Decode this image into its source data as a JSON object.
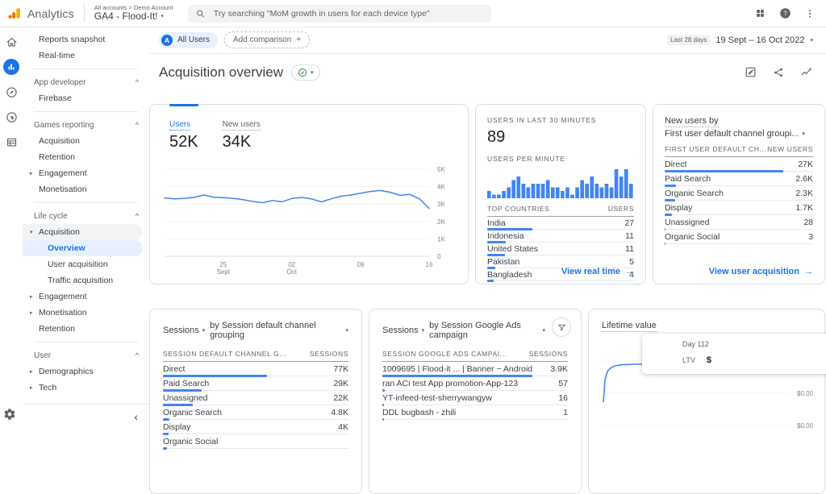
{
  "topbar": {
    "brand": "Analytics",
    "account_breadcrumb": "All accounts > Demo Account",
    "property_name": "GA4 - Flood-It!",
    "search_placeholder": "Try searching \"MoM growth in users for each device type\""
  },
  "comparison_bar": {
    "avatar_letter": "A",
    "all_users_label": "All Users",
    "add_comparison_label": "Add comparison",
    "add_icon": "+"
  },
  "date_range": {
    "preset": "Last 28 days",
    "range": "19 Sept – 16 Oct 2022"
  },
  "page": {
    "title": "Acquisition overview"
  },
  "sidebar": {
    "collapse_icon": "‹",
    "items": [
      {
        "type": "link",
        "label": "Reports snapshot"
      },
      {
        "type": "link",
        "label": "Real-time"
      },
      {
        "type": "divider"
      },
      {
        "type": "header",
        "label": "App developer"
      },
      {
        "type": "link",
        "label": "Firebase"
      },
      {
        "type": "divider"
      },
      {
        "type": "header",
        "label": "Games reporting"
      },
      {
        "type": "link",
        "label": "Acquisition"
      },
      {
        "type": "link",
        "label": "Retention"
      },
      {
        "type": "link",
        "label": "Engagement",
        "arrow": "right"
      },
      {
        "type": "link",
        "label": "Monetisation"
      },
      {
        "type": "divider"
      },
      {
        "type": "header",
        "label": "Life cycle"
      },
      {
        "type": "link",
        "label": "Acquisition",
        "arrow": "down",
        "active_parent": true
      },
      {
        "type": "link",
        "label": "Overview",
        "indent": 2,
        "selected": true
      },
      {
        "type": "link",
        "label": "User acquisition",
        "indent": 2
      },
      {
        "type": "link",
        "label": "Traffic acquisition",
        "indent": 2
      },
      {
        "type": "link",
        "label": "Engagement",
        "arrow": "right"
      },
      {
        "type": "link",
        "label": "Monetisation",
        "arrow": "right"
      },
      {
        "type": "link",
        "label": "Retention"
      },
      {
        "type": "divider"
      },
      {
        "type": "header",
        "label": "User"
      },
      {
        "type": "link",
        "label": "Demographics",
        "arrow": "right"
      },
      {
        "type": "link",
        "label": "Tech",
        "arrow": "right"
      }
    ]
  },
  "cards": {
    "users_trend": {
      "tabs": [
        {
          "label": "Users",
          "value": "52K"
        },
        {
          "label": "New users",
          "value": "34K"
        }
      ]
    },
    "realtime": {
      "title": "USERS IN LAST 30 MINUTES",
      "value": "89",
      "chart_label": "USERS PER MINUTE",
      "table_headers": [
        "TOP COUNTRIES",
        "USERS"
      ],
      "rows": [
        {
          "label": "India",
          "value": "27",
          "bar": 0.31
        },
        {
          "label": "Indonesia",
          "value": "11",
          "bar": 0.125
        },
        {
          "label": "United States",
          "value": "11",
          "bar": 0.12
        },
        {
          "label": "Pakistan",
          "value": "5",
          "bar": 0.055
        },
        {
          "label": "Bangladesh",
          "value": "4",
          "bar": 0.045
        }
      ],
      "link": "View real time"
    },
    "new_users_by": {
      "title_line1": "New users by",
      "title_line2": "First user default channel groupi...",
      "table_headers": [
        "FIRST USER DEFAULT CH...",
        "NEW USERS"
      ],
      "rows": [
        {
          "label": "Direct",
          "value": "27K",
          "bar": 0.8
        },
        {
          "label": "Paid Search",
          "value": "2.6K",
          "bar": 0.077
        },
        {
          "label": "Organic Search",
          "value": "2.3K",
          "bar": 0.068
        },
        {
          "label": "Display",
          "value": "1.7K",
          "bar": 0.05
        },
        {
          "label": "Unassigned",
          "value": "28",
          "bar": 0.004
        },
        {
          "label": "Organic Social",
          "value": "3",
          "bar": 0.002
        }
      ],
      "link": "View user acquisition"
    },
    "sessions_channel": {
      "metric": "Sessions",
      "by_label": "by Session default channel grouping",
      "table_headers": [
        "SESSION DEFAULT CHANNEL G...",
        "SESSIONS"
      ],
      "rows": [
        {
          "label": "Direct",
          "value": "77K",
          "bar": 0.56
        },
        {
          "label": "Paid Search",
          "value": "29K",
          "bar": 0.21
        },
        {
          "label": "Unassigned",
          "value": "22K",
          "bar": 0.16
        },
        {
          "label": "Organic Search",
          "value": "4.8K",
          "bar": 0.035
        },
        {
          "label": "Display",
          "value": "4K",
          "bar": 0.029
        },
        {
          "label": "Organic Social",
          "value": "",
          "bar": 0.02
        }
      ]
    },
    "sessions_campaign": {
      "metric": "Sessions",
      "by_label": "by Session Google Ads campaign",
      "table_headers": [
        "SESSION GOOGLE ADS CAMPAI...",
        "SESSIONS"
      ],
      "rows": [
        {
          "label": "1009695 | Flood-it ... | Banner ~ Android",
          "value": "3.9K",
          "bar": 0.81
        },
        {
          "label": "ran ACi test App promotion-App-123",
          "value": "57",
          "bar": 0.012
        },
        {
          "label": "YT-infeed-test-sherrywangyw",
          "value": "16",
          "bar": 0.006
        },
        {
          "label": "DDL bugbash - zhili",
          "value": "1",
          "bar": 0.002
        }
      ]
    },
    "lifetime_value": {
      "title": "Lifetime value",
      "tooltip": {
        "line1": "Day 112",
        "label": "LTV",
        "value": "$"
      }
    }
  },
  "chart_data": [
    {
      "id": "users_trend",
      "type": "line",
      "title": "Users (last 28 days)",
      "x_range": [
        "19 Sept 2022",
        "16 Oct 2022"
      ],
      "values": [
        3350,
        3300,
        3330,
        3380,
        3520,
        3400,
        3370,
        3330,
        3250,
        3150,
        3080,
        3200,
        3130,
        3320,
        3380,
        3300,
        3120,
        3300,
        3450,
        3520,
        3620,
        3720,
        3780,
        3680,
        3500,
        3560,
        3300,
        2750
      ],
      "ylim": [
        0,
        5000
      ],
      "yticks": [
        {
          "v": 0,
          "label": "0"
        },
        {
          "v": 1000,
          "label": "1K"
        },
        {
          "v": 2000,
          "label": "2K"
        },
        {
          "v": 3000,
          "label": "3K"
        },
        {
          "v": 4000,
          "label": "4K"
        },
        {
          "v": 5000,
          "label": "5K"
        }
      ],
      "xticks": [
        {
          "label": "25",
          "sub": "Sept",
          "pos": 0.222
        },
        {
          "label": "02",
          "sub": "Oct",
          "pos": 0.481
        },
        {
          "label": "09",
          "sub": "",
          "pos": 0.741
        },
        {
          "label": "16",
          "sub": "",
          "pos": 1.0
        }
      ],
      "grid": true,
      "line_color": "#4285f4"
    },
    {
      "id": "users_per_minute",
      "type": "bar",
      "title": "Users per minute (last 30 minutes)",
      "values": [
        2,
        1,
        1,
        2,
        3,
        5,
        6,
        4,
        3,
        4,
        4,
        4,
        5,
        3,
        3,
        2,
        3,
        1,
        3,
        5,
        4,
        6,
        4,
        3,
        4,
        3,
        8,
        6,
        8,
        4
      ],
      "ymax": 8,
      "bar_color": "#4285f4"
    },
    {
      "id": "lifetime_value",
      "type": "line",
      "title": "Lifetime value",
      "xlim": [
        0,
        120
      ],
      "points": [
        [
          0,
          0
        ],
        [
          1,
          0.45
        ],
        [
          2,
          0.58
        ],
        [
          3,
          0.66
        ],
        [
          5,
          0.72
        ],
        [
          8,
          0.76
        ],
        [
          12,
          0.78
        ],
        [
          20,
          0.79
        ],
        [
          40,
          0.8
        ],
        [
          60,
          0.8
        ],
        [
          62,
          0.84
        ],
        [
          90,
          0.84
        ],
        [
          112,
          0.84
        ],
        [
          120,
          0.84
        ]
      ],
      "marker": [
        112,
        0.84
      ],
      "yticks": [
        "$0.00",
        "$0.00",
        "$0.00"
      ],
      "y_note": "all visible gridline labels round to $0.00",
      "line_color": "#4285f4"
    }
  ]
}
